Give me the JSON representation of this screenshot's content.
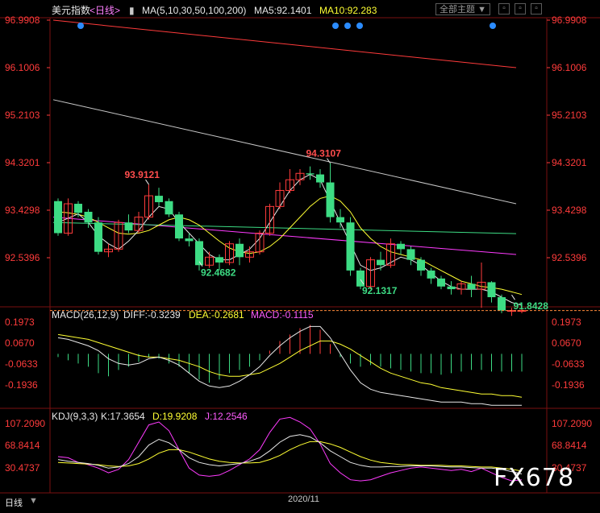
{
  "header": {
    "symbol": "美元指数",
    "period": "<日线>",
    "ma_def": "MA(5,10,30,50,100,200)",
    "ma5": "MA5:92.1401",
    "ma10": "MA10:92.283"
  },
  "toolbar": {
    "theme_label": "全部主题",
    "theme_arrow": "▼",
    "btn1": "",
    "btn2": "",
    "btn3": ""
  },
  "price_axis": [
    "96.9908",
    "96.1006",
    "95.2103",
    "94.3201",
    "93.4298",
    "92.5396"
  ],
  "price_ticks": [
    96.9908,
    96.1006,
    95.2103,
    94.3201,
    93.4298,
    92.5396
  ],
  "annotations": [
    {
      "text": "93.9121",
      "price": 93.9121,
      "idx": 9,
      "color": "#ff4d4d"
    },
    {
      "text": "94.3107",
      "price": 94.3107,
      "idx": 27,
      "color": "#ff4d4d"
    },
    {
      "text": "92.4682",
      "price": 92.4682,
      "idx": 14,
      "color": "#3ddc84"
    },
    {
      "text": "92.1317",
      "price": 92.1317,
      "idx": 30,
      "color": "#3ddc84"
    },
    {
      "text": "91.8428",
      "price": 91.8428,
      "idx": 45,
      "color": "#3ddc84"
    }
  ],
  "macd": {
    "label": "MACD(26,12,9)",
    "diff": "DIFF:-0.3239",
    "dea": "DEA:-0.2681",
    "macd": "MACD:-0.1115",
    "axis": [
      "0.1973",
      "0.0670",
      "-0.0633",
      "-0.1936"
    ],
    "ticks": [
      0.1973,
      0.067,
      -0.0633,
      -0.1936
    ]
  },
  "kdj": {
    "label": "KDJ(9,3,3)",
    "k": "K:17.3654",
    "d": "D:19.9208",
    "j": "J:12.2546",
    "axis": [
      "107.2090",
      "68.8414",
      "30.4737"
    ],
    "ticks": [
      107.209,
      68.8414,
      30.4737
    ]
  },
  "footer": {
    "date": "2020/11",
    "tab": "日线"
  },
  "watermark": "FX678",
  "colors": {
    "up": "#ff3b3b",
    "down": "#3ddc84",
    "bg": "#000000",
    "axis": "#ff3b3b"
  },
  "chart_data": {
    "type": "candlestick",
    "candles": [
      [
        93.6,
        93.0,
        93.65,
        92.95
      ],
      [
        93.0,
        93.55,
        93.65,
        92.95
      ],
      [
        93.55,
        93.38,
        93.6,
        93.3
      ],
      [
        93.4,
        93.2,
        93.45,
        93.1
      ],
      [
        93.2,
        92.65,
        93.3,
        92.6
      ],
      [
        92.65,
        92.7,
        92.8,
        92.55
      ],
      [
        92.7,
        93.2,
        93.25,
        92.65
      ],
      [
        93.2,
        93.05,
        93.35,
        93.0
      ],
      [
        93.05,
        93.3,
        93.4,
        93.0
      ],
      [
        93.3,
        93.7,
        93.91,
        93.25
      ],
      [
        93.7,
        93.58,
        93.85,
        93.5
      ],
      [
        93.6,
        93.35,
        93.65,
        93.3
      ],
      [
        93.35,
        92.9,
        93.4,
        92.85
      ],
      [
        92.9,
        92.85,
        93.0,
        92.75
      ],
      [
        92.85,
        92.4,
        92.9,
        92.3
      ],
      [
        92.4,
        92.55,
        92.65,
        92.35
      ],
      [
        92.55,
        92.45,
        92.6,
        92.3
      ],
      [
        92.45,
        92.8,
        92.85,
        92.4
      ],
      [
        92.8,
        92.55,
        92.9,
        92.4
      ],
      [
        92.55,
        92.65,
        92.75,
        92.45
      ],
      [
        92.65,
        93.0,
        93.05,
        92.6
      ],
      [
        93.0,
        93.5,
        93.55,
        92.95
      ],
      [
        93.5,
        93.8,
        93.95,
        93.45
      ],
      [
        93.8,
        94.0,
        94.2,
        93.75
      ],
      [
        94.0,
        94.12,
        94.2,
        93.9
      ],
      [
        94.12,
        94.1,
        94.25,
        94.0
      ],
      [
        94.1,
        93.95,
        94.2,
        93.85
      ],
      [
        93.95,
        93.3,
        94.31,
        93.2
      ],
      [
        93.3,
        93.2,
        93.45,
        93.1
      ],
      [
        93.2,
        92.3,
        93.3,
        92.2
      ],
      [
        92.3,
        92.0,
        92.35,
        91.95
      ],
      [
        92.0,
        92.5,
        92.55,
        91.95
      ],
      [
        92.5,
        92.4,
        92.65,
        92.3
      ],
      [
        92.4,
        92.8,
        92.9,
        92.35
      ],
      [
        92.8,
        92.7,
        92.85,
        92.6
      ],
      [
        92.7,
        92.5,
        92.75,
        92.4
      ],
      [
        92.5,
        92.3,
        92.55,
        92.2
      ],
      [
        92.3,
        92.15,
        92.35,
        92.05
      ],
      [
        92.15,
        92.0,
        92.2,
        91.95
      ],
      [
        92.0,
        91.95,
        92.1,
        91.85
      ],
      [
        91.95,
        92.05,
        92.1,
        91.85
      ],
      [
        92.05,
        91.95,
        92.2,
        91.8
      ],
      [
        91.95,
        92.08,
        92.45,
        91.6
      ],
      [
        92.08,
        91.8,
        92.1,
        91.7
      ],
      [
        91.8,
        91.55,
        91.85,
        91.5
      ],
      [
        91.55,
        91.55,
        91.6,
        91.45
      ],
      [
        91.55,
        91.55,
        91.6,
        91.5
      ]
    ],
    "ma_series": [
      {
        "color": "#ff3b3b",
        "values": [
          96.99,
          96.1
        ]
      },
      {
        "color": "#c8c8c8",
        "values": [
          95.5,
          93.55
        ]
      },
      {
        "color": "#ff3bff",
        "values": [
          93.3,
          92.6
        ]
      },
      {
        "color": "#3ddc84",
        "values": [
          93.2,
          92.99
        ]
      }
    ],
    "daily_ma": {
      "white": [
        93.2,
        93.28,
        93.36,
        93.2,
        92.95,
        92.8,
        92.7,
        92.85,
        93.05,
        93.3,
        93.5,
        93.45,
        93.2,
        93.0,
        92.8,
        92.6,
        92.5,
        92.5,
        92.6,
        92.7,
        92.9,
        93.2,
        93.5,
        93.8,
        94.0,
        94.1,
        94.0,
        93.6,
        93.2,
        92.8,
        92.4,
        92.3,
        92.35,
        92.45,
        92.55,
        92.5,
        92.4,
        92.25,
        92.1,
        92.0,
        91.95,
        91.95,
        91.95,
        91.9,
        91.8,
        91.7,
        91.65
      ],
      "yellow": [
        93.4,
        93.38,
        93.35,
        93.3,
        93.2,
        93.1,
        93.0,
        92.98,
        93.0,
        93.05,
        93.15,
        93.25,
        93.3,
        93.25,
        93.15,
        93.0,
        92.85,
        92.72,
        92.65,
        92.62,
        92.65,
        92.75,
        92.9,
        93.1,
        93.3,
        93.5,
        93.65,
        93.7,
        93.6,
        93.4,
        93.1,
        92.9,
        92.75,
        92.65,
        92.6,
        92.55,
        92.5,
        92.4,
        92.3,
        92.2,
        92.1,
        92.05,
        92.0,
        91.98,
        91.95,
        91.9,
        91.85
      ]
    },
    "macd_bars": [
      -0.02,
      -0.04,
      -0.06,
      -0.08,
      -0.12,
      -0.14,
      -0.1,
      -0.08,
      -0.05,
      -0.02,
      -0.03,
      -0.06,
      -0.08,
      -0.12,
      -0.16,
      -0.18,
      -0.16,
      -0.12,
      -0.1,
      -0.08,
      -0.04,
      0.02,
      0.08,
      0.12,
      0.16,
      0.18,
      0.15,
      0.06,
      -0.02,
      -0.06,
      -0.08,
      -0.07,
      -0.08,
      -0.09,
      -0.1,
      -0.11,
      -0.12,
      -0.12,
      -0.13,
      -0.12,
      -0.11,
      -0.1,
      -0.1,
      -0.11,
      -0.11,
      -0.11,
      -0.11
    ],
    "macd_diff": [
      0.1,
      0.09,
      0.07,
      0.05,
      0.02,
      -0.03,
      -0.06,
      -0.07,
      -0.06,
      -0.03,
      -0.02,
      -0.04,
      -0.07,
      -0.12,
      -0.17,
      -0.2,
      -0.21,
      -0.2,
      -0.17,
      -0.13,
      -0.08,
      -0.01,
      0.05,
      0.1,
      0.14,
      0.17,
      0.17,
      0.1,
      0.0,
      -0.1,
      -0.18,
      -0.22,
      -0.24,
      -0.25,
      -0.26,
      -0.27,
      -0.28,
      -0.29,
      -0.3,
      -0.3,
      -0.3,
      -0.31,
      -0.31,
      -0.32,
      -0.32,
      -0.32,
      -0.32
    ],
    "macd_dea": [
      0.12,
      0.11,
      0.1,
      0.09,
      0.07,
      0.05,
      0.03,
      0.01,
      -0.01,
      -0.02,
      -0.02,
      -0.03,
      -0.04,
      -0.06,
      -0.08,
      -0.11,
      -0.13,
      -0.14,
      -0.14,
      -0.13,
      -0.12,
      -0.09,
      -0.06,
      -0.02,
      0.02,
      0.05,
      0.08,
      0.08,
      0.06,
      0.03,
      -0.01,
      -0.05,
      -0.09,
      -0.12,
      -0.14,
      -0.16,
      -0.18,
      -0.19,
      -0.21,
      -0.22,
      -0.23,
      -0.24,
      -0.25,
      -0.25,
      -0.26,
      -0.26,
      -0.27
    ],
    "kdj_k": [
      45,
      42,
      40,
      38,
      35,
      30,
      32,
      38,
      50,
      70,
      80,
      74,
      62,
      48,
      40,
      36,
      34,
      36,
      38,
      42,
      48,
      60,
      75,
      85,
      88,
      84,
      74,
      60,
      50,
      40,
      35,
      32,
      32,
      33,
      33,
      34,
      34,
      34,
      33,
      32,
      32,
      31,
      30,
      30,
      28,
      24,
      20
    ],
    "kdj_d": [
      40,
      39,
      38,
      37,
      36,
      34,
      33,
      34,
      38,
      46,
      56,
      62,
      62,
      58,
      52,
      46,
      42,
      40,
      39,
      39,
      40,
      45,
      52,
      62,
      70,
      76,
      76,
      72,
      66,
      58,
      50,
      44,
      40,
      38,
      36,
      36,
      35,
      35,
      35,
      34,
      34,
      33,
      32,
      32,
      30,
      28,
      25
    ],
    "kdj_j": [
      50,
      48,
      40,
      36,
      30,
      22,
      28,
      45,
      75,
      105,
      110,
      95,
      62,
      30,
      18,
      16,
      18,
      26,
      36,
      46,
      62,
      92,
      115,
      118,
      110,
      98,
      72,
      38,
      22,
      10,
      8,
      10,
      16,
      22,
      26,
      30,
      32,
      30,
      28,
      26,
      28,
      24,
      30,
      22,
      14,
      8,
      10
    ]
  }
}
